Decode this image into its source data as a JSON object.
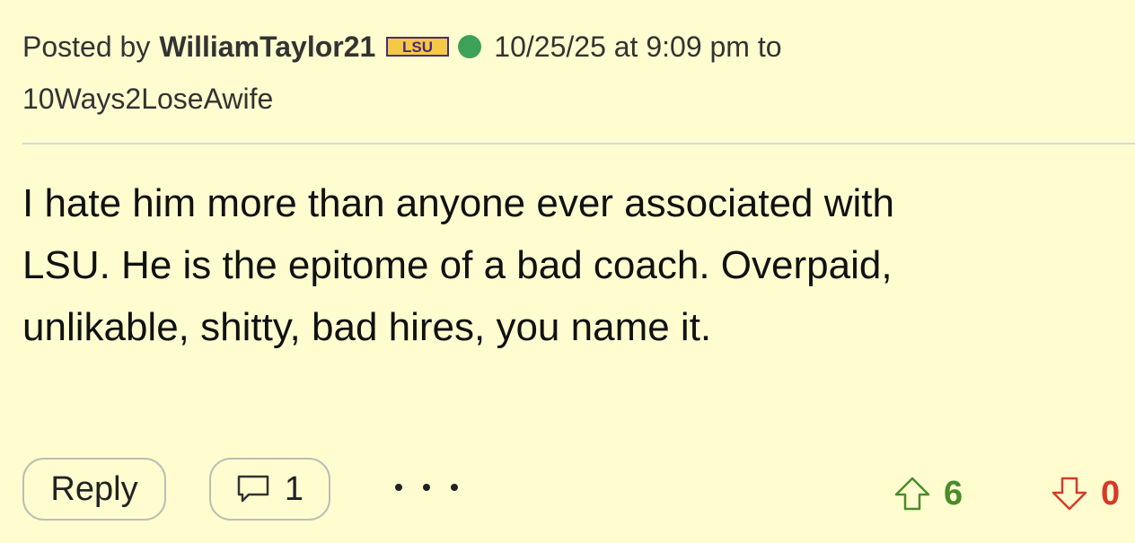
{
  "post": {
    "posted_by_prefix": "Posted by",
    "username": "WilliamTaylor21",
    "team_badge": "LSU",
    "online_color": "#3DA15A",
    "timestamp": "10/25/25 at 9:09 pm to",
    "reply_to": "10Ways2LoseAwife",
    "body_lines": [
      "I hate him more than anyone ever associated with",
      "LSU. He is the epitome of a bad coach. Overpaid,",
      "unlikable, shitty, bad hires, you name it."
    ]
  },
  "actions": {
    "reply_label": "Reply",
    "comment_count": "1",
    "more_icon": "ellipsis-icon",
    "upvotes": "6",
    "downvotes": "0",
    "upvote_color": "#4A8C2A",
    "downvote_color": "#D63A2A"
  }
}
